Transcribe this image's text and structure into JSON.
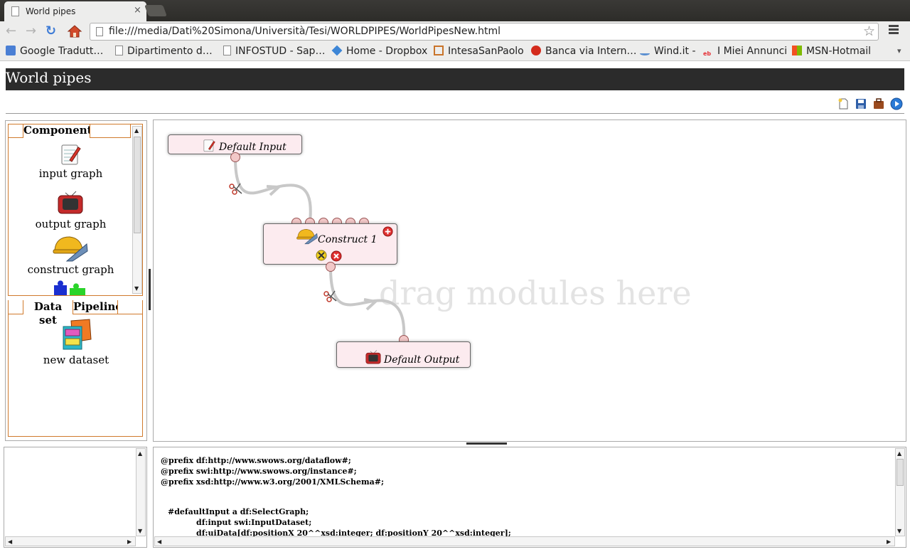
{
  "browser": {
    "tab_title": "World pipes",
    "tab_close": "×",
    "url": "file:///media/Dati%20Simona/Università/Tesi/WORLDPIPES/WorldPipesNew.html",
    "nav": {
      "back": "←",
      "forward": "→",
      "reload": "↻",
      "star": "☆"
    },
    "bookmarks": [
      {
        "label": "Google Tradutt…",
        "icon": "google-translate-icon",
        "color": "#4a7fd4"
      },
      {
        "label": "Dipartimento d…",
        "icon": "page-icon",
        "color": "#ffffff"
      },
      {
        "label": "INFOSTUD - Sap…",
        "icon": "page-icon",
        "color": "#ffffff"
      },
      {
        "label": "Home - Dropbox",
        "icon": "dropbox-icon",
        "color": "#3d86d6"
      },
      {
        "label": "IntesaSanPaolo",
        "icon": "intesa-icon",
        "color": "#c9742a"
      },
      {
        "label": "Banca via Intern…",
        "icon": "unicredit-icon",
        "color": "#d42b1c"
      },
      {
        "label": "Wind.it -",
        "icon": "wind-icon",
        "color": "#5a8fd0"
      },
      {
        "label": "I Miei Annunci",
        "icon": "ebay-icon",
        "color": "#e53238"
      },
      {
        "label": "MSN-Hotmail",
        "icon": "windows-icon",
        "color": "#f25022"
      }
    ],
    "bookmarks_overflow": "▾"
  },
  "app": {
    "title": "World pipes",
    "toolbar": [
      "new-document-icon",
      "save-icon",
      "briefcase-icon",
      "run-icon"
    ]
  },
  "left_panel": {
    "components_tab": "Componenti",
    "components": [
      {
        "label": "input graph",
        "icon": "notepad-pencil-icon"
      },
      {
        "label": "output graph",
        "icon": "tv-icon"
      },
      {
        "label": "construct graph",
        "icon": "hardhat-tools-icon"
      },
      {
        "label": "",
        "icon": "puzzle-icon"
      }
    ],
    "dataset_tab": "Data set",
    "pipeline_tab": "Pipeline",
    "datasets": [
      {
        "label": "new dataset",
        "icon": "filing-cabinet-icon"
      }
    ]
  },
  "canvas": {
    "hint": "drag modules here",
    "modules": {
      "input": {
        "title": "Default Input",
        "icon": "notepad-pencil-icon"
      },
      "construct": {
        "title": "Construct 1",
        "icon": "hardhat-tools-icon"
      },
      "output": {
        "title": "Default Output",
        "icon": "tv-icon"
      }
    },
    "colors": {
      "module_bg": "#fcebef",
      "wire": "#c8c8c8",
      "terminal": "#f2c8c8"
    }
  },
  "code": {
    "lines": [
      "@prefix df:http://www.swows.org/dataflow#;",
      "@prefix swi:http://www.swows.org/instance#;",
      "@prefix xsd:http://www.w3.org/2001/XMLSchema#;",
      "#defaultInput a df:SelectGraph;",
      "df:input swi:InputDataset;",
      "df:uiData[df:positionX 20^^xsd:integer; df:positionY 20^^xsd:integer];"
    ]
  }
}
